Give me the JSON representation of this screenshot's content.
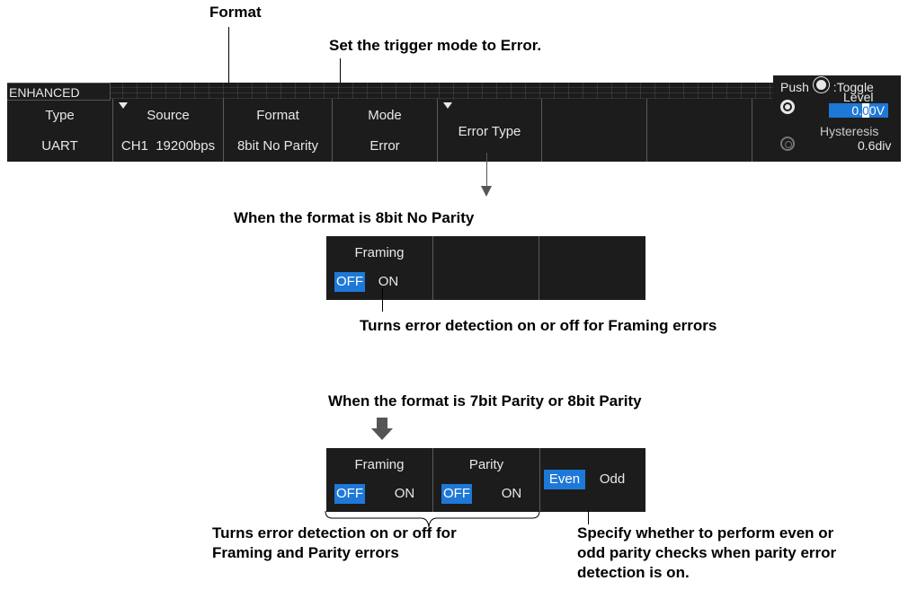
{
  "callouts": {
    "format": "Format",
    "mode": "Set the trigger mode to Error.",
    "case1": "When the format is 8bit No Parity",
    "framing_note": "Turns error detection on or off for Framing errors",
    "case2": "When the format is 7bit Parity or 8bit Parity",
    "bottom_left": [
      "Turns error detection on or off for",
      "Framing and Parity errors"
    ],
    "bottom_right": [
      "Specify whether to perform even or",
      "odd parity checks when parity error",
      "detection is on."
    ]
  },
  "menu": {
    "tab": "ENHANCED",
    "items": [
      {
        "title": "Type",
        "value": "UART"
      },
      {
        "title": "Source",
        "value": "CH1  19200bps"
      },
      {
        "title": "Format",
        "value": "8bit No Parity"
      },
      {
        "title": "Mode",
        "value": "Error"
      },
      {
        "title": "Error Type",
        "value": ""
      }
    ]
  },
  "knob": {
    "push": "Push",
    "toggle": ":Toggle",
    "level_label": "Level",
    "level_prefix": "0.",
    "level_digit": "0",
    "level_suffix": "0V",
    "hyst_label": "Hysteresis",
    "hyst_value": "0.6div"
  },
  "panel1": {
    "title": "Framing",
    "off": "OFF",
    "on": "ON"
  },
  "panel2": {
    "framing_title": "Framing",
    "parity_title": "Parity",
    "off": "OFF",
    "on": "ON",
    "even": "Even",
    "odd": "Odd"
  },
  "colors": {
    "highlight": "#1e78d7",
    "panel_bg": "#1c1c1c"
  }
}
